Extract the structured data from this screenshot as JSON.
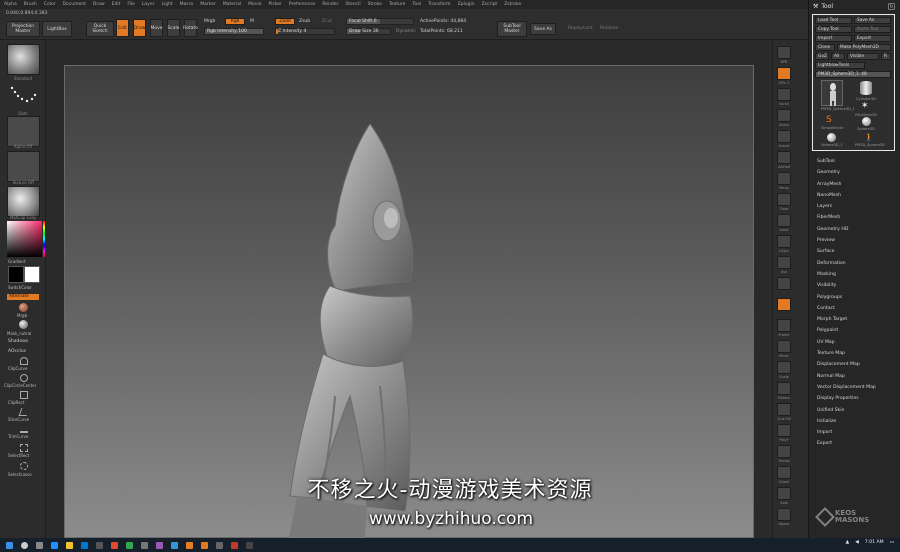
{
  "menubar": [
    "Alpha",
    "Brush",
    "Color",
    "Document",
    "Draw",
    "Edit",
    "File",
    "Layer",
    "Light",
    "Macro",
    "Marker",
    "Material",
    "Movie",
    "Picker",
    "Preferences",
    "Render",
    "Stencil",
    "Stroke",
    "Texture",
    "Tool",
    "Transform",
    "Zplugin",
    "Zscript",
    "Zstroke"
  ],
  "coords": "0.040,0.894,0.383",
  "topshelf": {
    "projection_master": "Projection Master",
    "lightbox": "LightBox",
    "quick_sketch": "Quick Sketch",
    "edit": "Edit",
    "draw": "Draw",
    "move": "Move",
    "scale": "Scale",
    "rotate": "Rotate",
    "mrgb": "Mrgb",
    "rgb": "Rgb",
    "m": "M",
    "rgb_intensity": "Rgb Intensity 100",
    "zadd": "Zadd",
    "zsub": "Zsub",
    "zcut": "Zcut",
    "z_intensity": "Z Intensity 4",
    "focal_shift": "Focal Shift 0",
    "draw_size": "Draw Size 36",
    "dynamic": "Dynamic",
    "active_points": "ActivePoints: 44,884",
    "total_points": "TotalPoints: 68,211",
    "subtool_master": "SubTool Master",
    "save_as": "Save As",
    "replay_last": "ReplayLast",
    "replay_relative": "Relative"
  },
  "leftshelf": {
    "brush_label": "Standard",
    "stroke_label": "Dots",
    "alpha_label": "Alpha Off",
    "texture_label": "Texture Off",
    "material_label": "MatCap Gray",
    "gradient": "Gradient",
    "switch_color": "SwitchColor",
    "alternate": "Alternate",
    "mrgb_small": "Mrgb",
    "mask_label": "Mask_nutral",
    "shadows": "Shadows",
    "aoclus": "AOcclus",
    "clip_curve": "ClipCurve",
    "clip_circle_center": "ClipCircleCenter",
    "clip_rect": "ClipRect",
    "slice_curve": "SliceCurve",
    "trim_curve": "TrimCurve",
    "select_rect": "SelectRect",
    "select_lasso": "SelectLasso"
  },
  "rightshelf": [
    "BPR",
    "SPix 3",
    "Scroll",
    "Zoom",
    "Actual",
    "AAHalf",
    "Persp",
    "Floor",
    "Local",
    "LSym",
    "Xyz",
    "",
    "",
    "Frame",
    "Move",
    "Scale",
    "Rotate",
    "Line Fill",
    "PolyF",
    "Transp",
    "Ghost",
    "Solo",
    "Xpose"
  ],
  "toolpanel": {
    "title": "Tool",
    "load_tool": "Load Tool",
    "save_as": "Save As",
    "copy_tool": "Copy Tool",
    "paste_tool": "Paste Tool",
    "import": "Import",
    "export": "Export",
    "clone": "Clone",
    "make_polymesh": "Make PolyMesh3D",
    "goz": "GoZ",
    "all": "All",
    "visible": "Visible",
    "r": "R",
    "lightbox_tools": "Lightbox▸Tools",
    "current_tool": "PM3D_Sphere3D_1. 48",
    "slots": [
      "PM3D_Sphere3D_1",
      "Cylinder3D",
      "PolyMesh3D",
      "SimpleBrush",
      "Sphere3D",
      "Sphere3D_1",
      "PM3D_Sphere3D"
    ],
    "sections": [
      "SubTool",
      "Geometry",
      "ArrayMesh",
      "NanoMesh",
      "Layers",
      "FiberMesh",
      "Geometry HD",
      "Preview",
      "Surface",
      "Deformation",
      "Masking",
      "Visibility",
      "Polygroups",
      "Contact",
      "Morph Target",
      "Polypaint",
      "UV Map",
      "Texture Map",
      "Displacement Map",
      "Normal Map",
      "Vector Displacement Map",
      "Display Properties",
      "Unified Skin",
      "Initialize",
      "Import",
      "Export"
    ]
  },
  "overlay": {
    "subtitle": "不移之火-动漫游戏美术资源",
    "watermark": "www.byzhihuo.com",
    "logo_line1": "KEOS",
    "logo_line2": "MASONS"
  },
  "taskbar": {
    "time": "7:01 AM"
  },
  "colors": {
    "accent": "#e27a23",
    "panel_bg": "#262626",
    "canvas_top": "#3e3e3e",
    "canvas_bottom": "#8c8c8c"
  }
}
